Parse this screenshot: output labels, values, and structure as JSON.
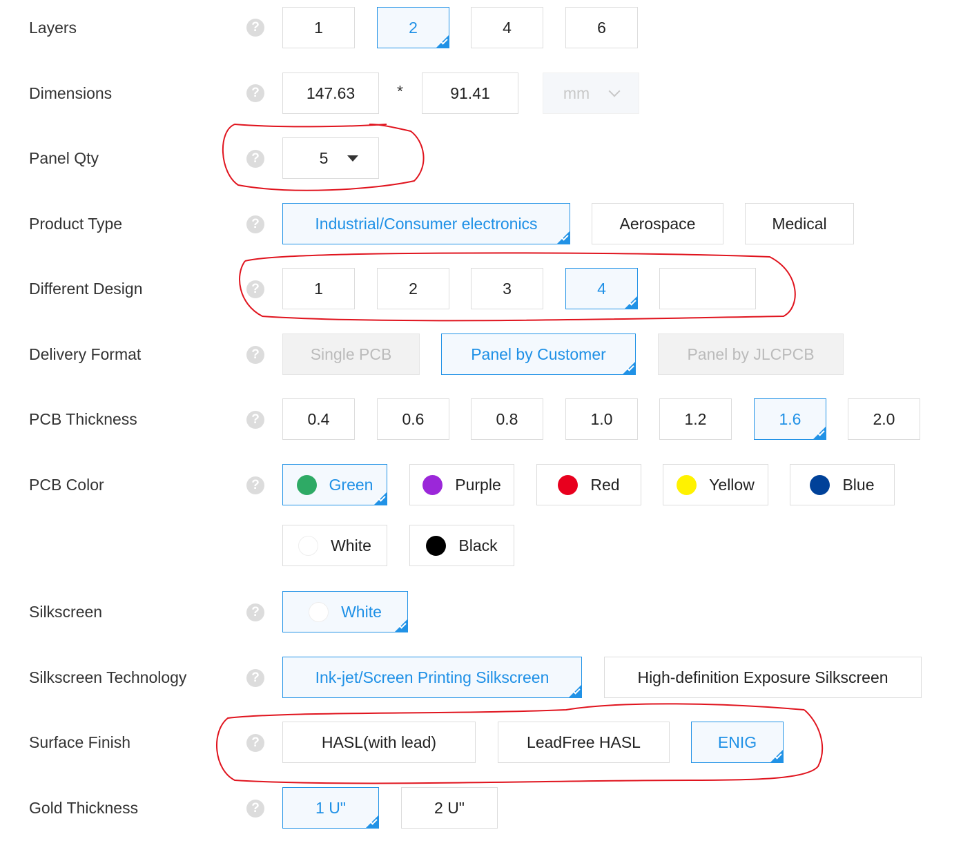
{
  "help_glyph": "?",
  "layers": {
    "label": "Layers",
    "options": [
      "1",
      "2",
      "4",
      "6"
    ],
    "selected": "2"
  },
  "dimensions": {
    "label": "Dimensions",
    "width": "147.63",
    "separator": "*",
    "height": "91.41",
    "unit": "mm"
  },
  "panel_qty": {
    "label": "Panel Qty",
    "value": "5"
  },
  "product_type": {
    "label": "Product Type",
    "options": [
      "Industrial/Consumer electronics",
      "Aerospace",
      "Medical"
    ],
    "selected": "Industrial/Consumer electronics"
  },
  "different_design": {
    "label": "Different Design",
    "options": [
      "1",
      "2",
      "3",
      "4"
    ],
    "selected": "4",
    "custom_value": ""
  },
  "delivery_format": {
    "label": "Delivery Format",
    "options": [
      "Single PCB",
      "Panel by Customer",
      "Panel by JLCPCB"
    ],
    "selected": "Panel by Customer",
    "disabled": [
      "Single PCB",
      "Panel by JLCPCB"
    ]
  },
  "pcb_thickness": {
    "label": "PCB Thickness",
    "options": [
      "0.4",
      "0.6",
      "0.8",
      "1.0",
      "1.2",
      "1.6",
      "2.0"
    ],
    "selected": "1.6"
  },
  "pcb_color": {
    "label": "PCB Color",
    "options": [
      {
        "name": "Green",
        "color": "#2eaa65"
      },
      {
        "name": "Purple",
        "color": "#9b27d9"
      },
      {
        "name": "Red",
        "color": "#e8001e"
      },
      {
        "name": "Yellow",
        "color": "#fff200"
      },
      {
        "name": "Blue",
        "color": "#004199"
      },
      {
        "name": "White",
        "color": "#ffffff"
      },
      {
        "name": "Black",
        "color": "#000000"
      }
    ],
    "selected": "Green"
  },
  "silkscreen": {
    "label": "Silkscreen",
    "options": [
      {
        "name": "White",
        "color": "#ffffff"
      }
    ],
    "selected": "White"
  },
  "silkscreen_technology": {
    "label": "Silkscreen Technology",
    "options": [
      "Ink-jet/Screen Printing Silkscreen",
      "High-definition Exposure Silkscreen"
    ],
    "selected": "Ink-jet/Screen Printing Silkscreen"
  },
  "surface_finish": {
    "label": "Surface Finish",
    "options": [
      "HASL(with lead)",
      "LeadFree HASL",
      "ENIG"
    ],
    "selected": "ENIG"
  },
  "gold_thickness": {
    "label": "Gold Thickness",
    "options": [
      "1 U\"",
      "2 U\""
    ],
    "selected": "1 U\""
  },
  "colors": {
    "accent": "#2192e6",
    "annotation": "#e0141e"
  }
}
